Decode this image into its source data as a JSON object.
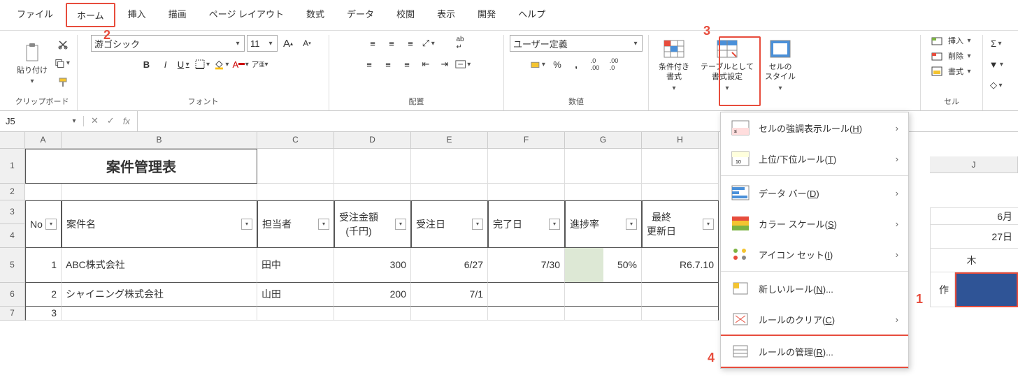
{
  "menubar": {
    "items": [
      "ファイル",
      "ホーム",
      "挿入",
      "描画",
      "ページ レイアウト",
      "数式",
      "データ",
      "校閲",
      "表示",
      "開発",
      "ヘルプ"
    ],
    "active_index": 1
  },
  "ribbon": {
    "clipboard": {
      "label": "クリップボード",
      "paste": "貼り付け"
    },
    "font": {
      "label": "フォント",
      "name": "游ゴシック",
      "size": "11"
    },
    "alignment": {
      "label": "配置"
    },
    "number": {
      "label": "数値",
      "format": "ユーザー定義"
    },
    "styles": {
      "conditional": "条件付き\n書式",
      "table_fmt": "テーブルとして\n書式設定",
      "cell_styles": "セルの\nスタイル"
    },
    "cells": {
      "label": "セル",
      "insert": "挿入",
      "delete": "削除",
      "format": "書式"
    }
  },
  "cf_menu": {
    "items": [
      {
        "label_prefix": "セルの強調表示ルール(",
        "key": "H",
        "label_suffix": ")",
        "arrow": true
      },
      {
        "label_prefix": "上位/下位ルール(",
        "key": "T",
        "label_suffix": ")",
        "arrow": true
      },
      {
        "label_prefix": "データ バー(",
        "key": "D",
        "label_suffix": ")",
        "arrow": true
      },
      {
        "label_prefix": "カラー スケール(",
        "key": "S",
        "label_suffix": ")",
        "arrow": true
      },
      {
        "label_prefix": "アイコン セット(",
        "key": "I",
        "label_suffix": ")",
        "arrow": true
      },
      {
        "label_prefix": "新しいルール(",
        "key": "N",
        "label_suffix": ")...",
        "arrow": false
      },
      {
        "label_prefix": "ルールのクリア(",
        "key": "C",
        "label_suffix": ")",
        "arrow": true
      },
      {
        "label_prefix": "ルールの管理(",
        "key": "R",
        "label_suffix": ")...",
        "arrow": false
      }
    ]
  },
  "formula_bar": {
    "cell_ref": "J5",
    "formula": ""
  },
  "columns": {
    "labels": [
      "A",
      "B",
      "C",
      "D",
      "E",
      "F",
      "G",
      "H",
      "J"
    ],
    "widths": [
      52,
      280,
      110,
      110,
      110,
      110,
      110,
      110,
      90
    ]
  },
  "row_heights": {
    "r1": 50,
    "r2": 24,
    "r3": 34,
    "r4": 34,
    "r5": 50,
    "r6": 34,
    "r7": 20
  },
  "headers": {
    "title": "案件管理表",
    "cols": [
      "No",
      "案件名",
      "担当者",
      "受注金額\n(千円)",
      "受注日",
      "完了日",
      "進捗率",
      "最終\n更新日"
    ]
  },
  "data_rows": [
    {
      "no": "1",
      "name": "ABC株式会社",
      "owner": "田中",
      "amount": "300",
      "order_date": "6/27",
      "complete": "7/30",
      "progress": "50%",
      "updated": "R6.7.10"
    },
    {
      "no": "2",
      "name": "シャイニング株式会社",
      "owner": "山田",
      "amount": "200",
      "order_date": "7/1",
      "complete": "",
      "progress": "",
      "updated": ""
    },
    {
      "no": "3",
      "name": "",
      "owner": "",
      "amount": "",
      "order_date": "",
      "complete": "",
      "progress": "",
      "updated": ""
    }
  ],
  "right_pane": {
    "rows": [
      "",
      "6月",
      "27日",
      "木",
      "作"
    ]
  },
  "annotations": {
    "a1": "1",
    "a2": "2",
    "a3": "3",
    "a4": "4"
  }
}
